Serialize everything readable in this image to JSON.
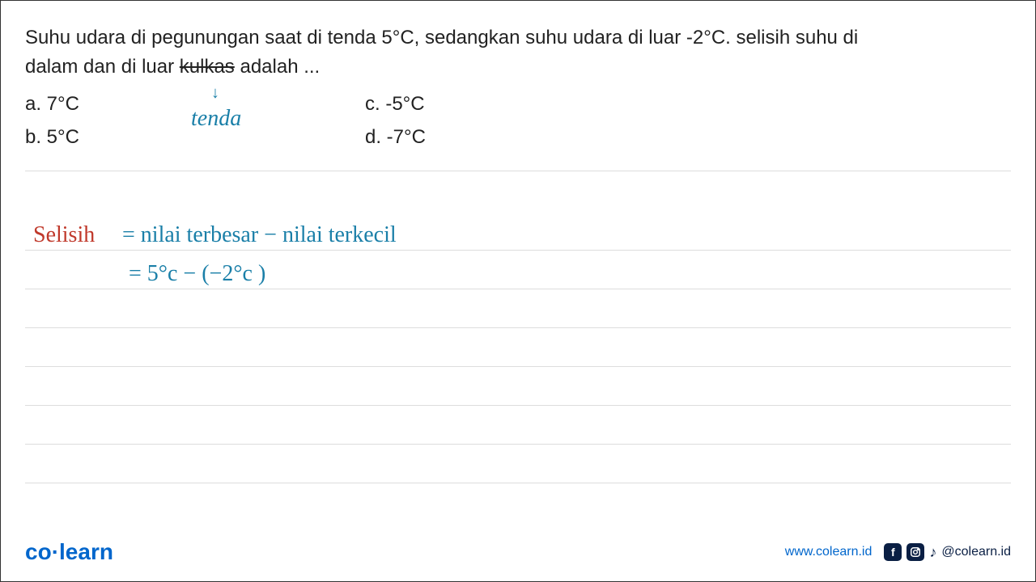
{
  "question": {
    "line1": "Suhu udara di pegunungan saat di tenda 5°C, sedangkan suhu udara di luar -2°C. selisih suhu di",
    "line2_pre": "dalam dan di luar ",
    "line2_strike": "kulkas",
    "line2_post": " adalah ..."
  },
  "options": {
    "a": "a.   7°C",
    "b": "b.   5°C",
    "c": "c. -5°C",
    "d": "d. -7°C"
  },
  "annotations": {
    "arrow": "↓",
    "tenda": "tenda"
  },
  "work": {
    "line1_red": "Selisih",
    "line1_teal": " =  nilai  terbesar  −  nilai  terkecil",
    "line2_teal": "=   5°c   −  (−2°c )"
  },
  "footer": {
    "logo_co": "co",
    "logo_dot": "·",
    "logo_learn": "learn",
    "website": "www.colearn.id",
    "handle": "@colearn.id"
  }
}
